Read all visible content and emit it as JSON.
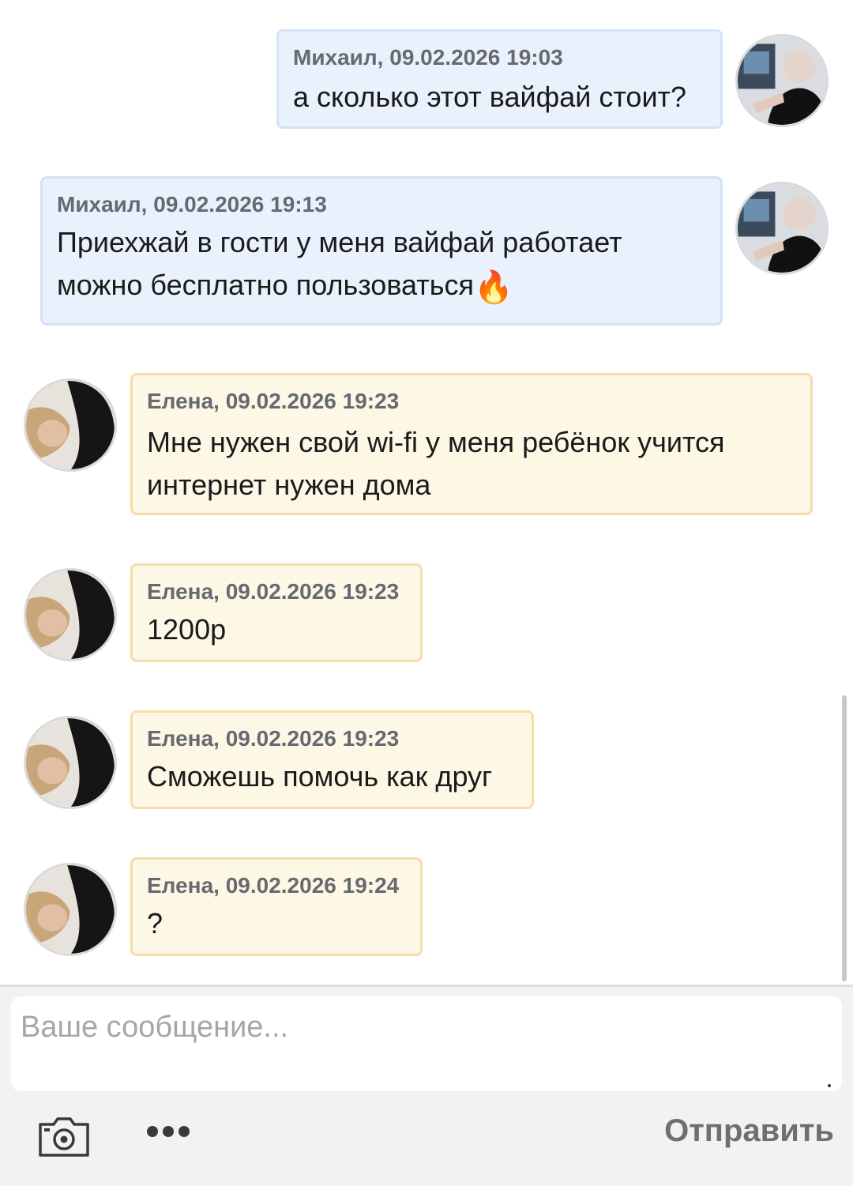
{
  "messages": [
    {
      "author": "Михаил",
      "meta": "Михаил, 09.02.2026 19:03",
      "text": "а сколько этот вайфай стоит?",
      "emoji": ""
    },
    {
      "author": "Михаил",
      "meta": "Михаил, 09.02.2026 19:13",
      "text": "Приехжай в гости у меня вайфай работает можно бесплатно пользоваться",
      "emoji": "🔥"
    },
    {
      "author": "Елена",
      "meta": "Елена, 09.02.2026 19:23",
      "text": "Мне нужен свой wi-fi у меня ребёнок учится интернет нужен дома",
      "emoji": ""
    },
    {
      "author": "Елена",
      "meta": "Елена, 09.02.2026 19:23",
      "text": "1200р",
      "emoji": ""
    },
    {
      "author": "Елена",
      "meta": "Елена, 09.02.2026 19:23",
      "text": "Сможешь помочь как друг",
      "emoji": ""
    },
    {
      "author": "Елена",
      "meta": "Елена, 09.02.2026 19:24",
      "text": "?",
      "emoji": ""
    }
  ],
  "composer": {
    "placeholder": "Ваше сообщение...",
    "send_label": "Отправить"
  },
  "colors": {
    "outgoing_bubble": "#e9f1fc",
    "incoming_bubble": "#fdf7e6",
    "meta_text": "#666a70"
  }
}
